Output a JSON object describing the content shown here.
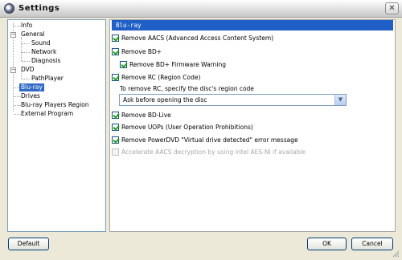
{
  "window": {
    "title": "Settings",
    "close_glyph": "✕"
  },
  "tree": {
    "items": [
      {
        "label": "Info"
      },
      {
        "label": "General"
      },
      {
        "label": "Sound"
      },
      {
        "label": "Network"
      },
      {
        "label": "Diagnosis"
      },
      {
        "label": "DVD"
      },
      {
        "label": "PathPlayer"
      },
      {
        "label": "Blu-ray"
      },
      {
        "label": "Drives"
      },
      {
        "label": "Blu-ray Players Region"
      },
      {
        "label": "External Program"
      }
    ],
    "expander_glyph": "−"
  },
  "panel": {
    "header": "Blu-ray",
    "options": [
      {
        "label": "Remove AACS (Advanced Access Content System)",
        "checked": true,
        "enabled": true
      },
      {
        "label": "Remove BD+",
        "checked": true,
        "enabled": true
      },
      {
        "label": "Remove BD+ Firmware Warning",
        "checked": true,
        "enabled": true
      },
      {
        "label": "Remove RC (Region Code)",
        "checked": true,
        "enabled": true
      },
      {
        "label": "Remove BD-Live",
        "checked": true,
        "enabled": true
      },
      {
        "label": "Remove UOPs (User Operation Prohibitions)",
        "checked": true,
        "enabled": true
      },
      {
        "label": "Remove PowerDVD \"Virtual drive detected\" error message",
        "checked": true,
        "enabled": true
      },
      {
        "label": "Accelerate AACS decryption by using intel AES-NI if available",
        "checked": false,
        "enabled": false
      }
    ],
    "region_prompt": "To remove RC, specify the disc's region code",
    "region_select": {
      "value": "Ask before opening the disc",
      "arrow_glyph": "▼"
    }
  },
  "buttons": {
    "default": "Default",
    "ok": "OK",
    "cancel": "Cancel"
  },
  "colors": {
    "header_bg": "#1f5fc6",
    "selection_bg": "#316ac5",
    "check_green": "#21a121"
  }
}
